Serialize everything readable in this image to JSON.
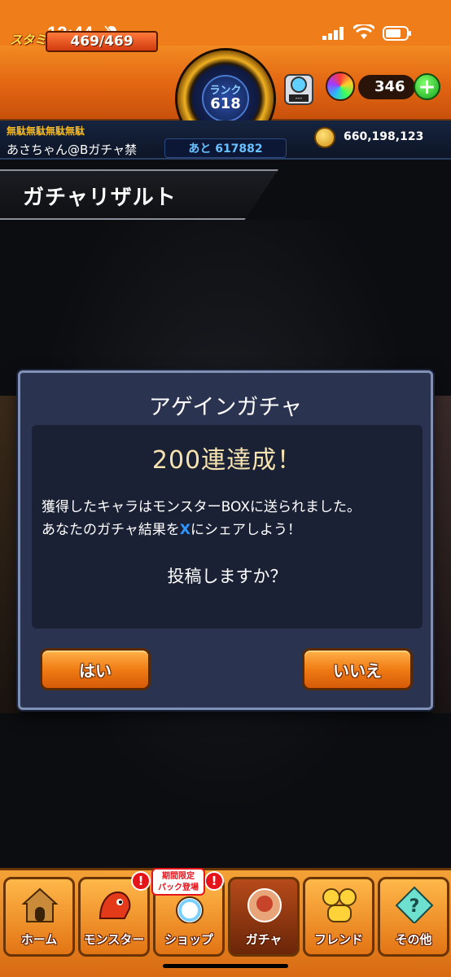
{
  "status_bar": {
    "time": "12:44"
  },
  "header": {
    "stamina_label": "スタミナ",
    "stamina_value": "469/469",
    "rank_label": "ランク",
    "rank_value": "618",
    "orb_count": "346",
    "machine_label": "---",
    "plus_label": "+"
  },
  "subheader": {
    "title_label": "無駄無駄無駄無駄",
    "user_name": "あさちゃん@Bガチャ禁",
    "exp_remaining": "あと 617882",
    "coin_count": "660,198,123"
  },
  "page": {
    "title": "ガチャリザルト"
  },
  "dialog": {
    "title": "アゲインガチャ",
    "achievement": "200連達成！",
    "message_line1": "獲得したキャラはモンスターBOXに送られました。",
    "message_line2_before": "あなたのガチャ結果を",
    "message_line2_highlight": "X",
    "message_line2_after": "にシェアしよう！",
    "question": "投稿しますか？",
    "yes_label": "はい",
    "no_label": "いいえ"
  },
  "nav": {
    "items": [
      {
        "label": "ホーム",
        "icon": "home-icon"
      },
      {
        "label": "モンスター",
        "icon": "monster-icon",
        "badge": "!"
      },
      {
        "label": "ショップ",
        "icon": "shop-icon",
        "badge": "!"
      },
      {
        "label": "ガチャ",
        "icon": "gacha-icon"
      },
      {
        "label": "フレンド",
        "icon": "friend-icon"
      },
      {
        "label": "その他",
        "icon": "other-icon"
      }
    ],
    "promo_line1": "期間限定",
    "promo_line2": "パック登場"
  },
  "colors": {
    "header_orange": "#ee7d1a",
    "dialog_bg": "#2a3350",
    "button_orange": "#f07c14",
    "x_blue": "#2f95ff",
    "achievement_text": "#f6e3b0"
  }
}
